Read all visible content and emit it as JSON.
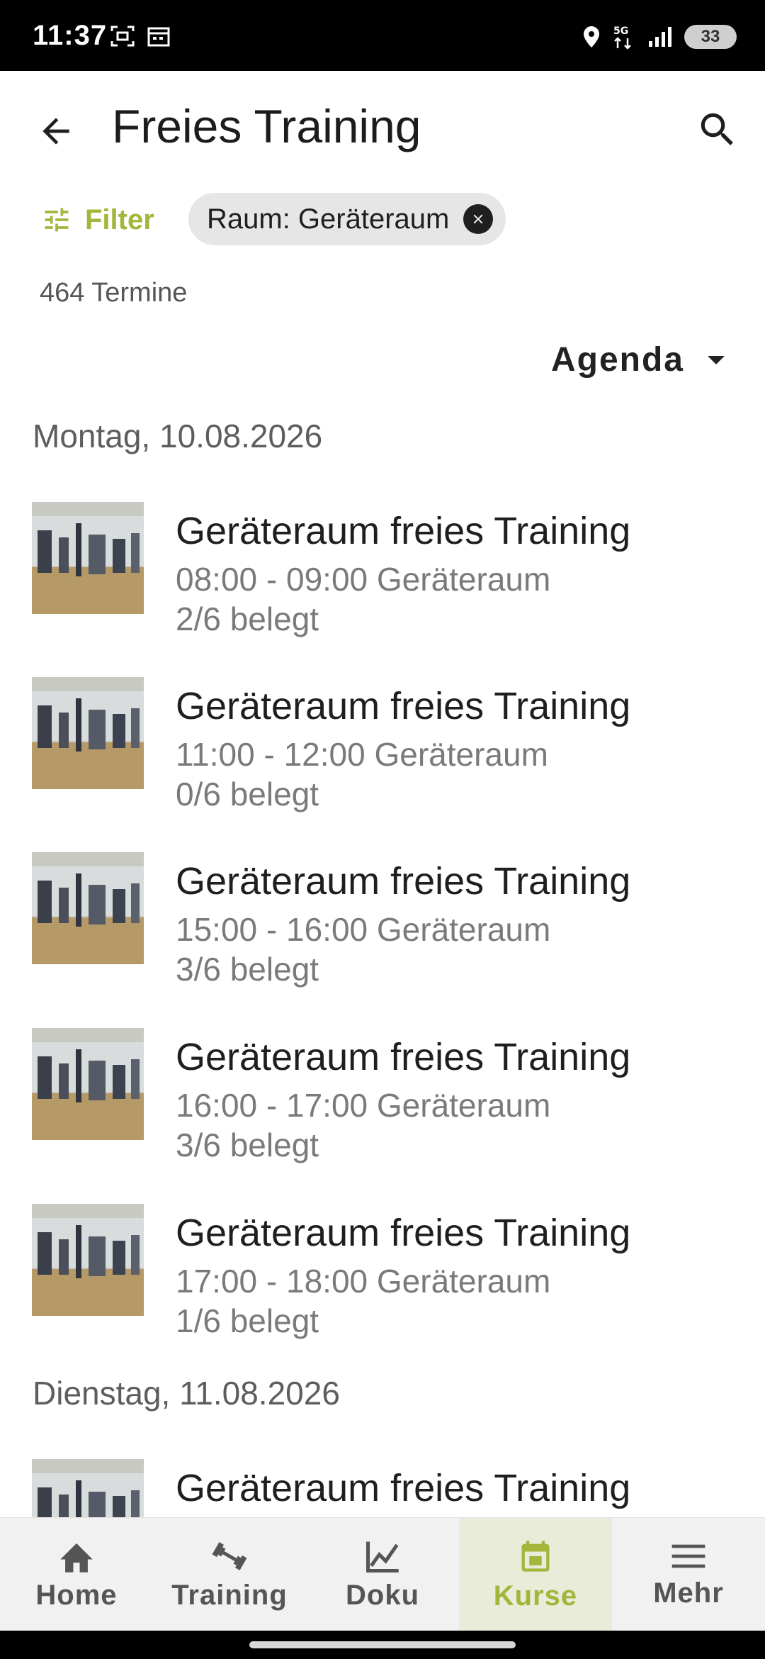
{
  "status_bar": {
    "time": "11:37",
    "battery": "33"
  },
  "app_bar": {
    "title": "Freies Training"
  },
  "filter": {
    "label": "Filter",
    "chip_label": "Raum: Geräteraum"
  },
  "result_count": "464 Termine",
  "view_selector": {
    "label": "Agenda"
  },
  "days": [
    {
      "header": "Montag, 10.08.2026",
      "events": [
        {
          "title": "Geräteraum freies Training",
          "time_room": "08:00 - 09:00 Geräteraum",
          "occupancy": "2/6 belegt"
        },
        {
          "title": "Geräteraum freies Training",
          "time_room": "11:00 - 12:00 Geräteraum",
          "occupancy": "0/6 belegt"
        },
        {
          "title": "Geräteraum freies Training",
          "time_room": "15:00 - 16:00 Geräteraum",
          "occupancy": "3/6 belegt"
        },
        {
          "title": "Geräteraum freies Training",
          "time_room": "16:00 - 17:00 Geräteraum",
          "occupancy": "3/6 belegt"
        },
        {
          "title": "Geräteraum freies Training",
          "time_room": "17:00 - 18:00 Geräteraum",
          "occupancy": "1/6 belegt"
        }
      ]
    },
    {
      "header": "Dienstag, 11.08.2026",
      "events": [
        {
          "title": "Geräteraum freies Training"
        }
      ]
    }
  ],
  "bottom_nav": [
    {
      "label": "Home",
      "icon": "home-icon"
    },
    {
      "label": "Training",
      "icon": "dumbbell-icon"
    },
    {
      "label": "Doku",
      "icon": "chart-line-icon"
    },
    {
      "label": "Kurse",
      "icon": "calendar-icon",
      "active": true
    },
    {
      "label": "Mehr",
      "icon": "menu-icon"
    }
  ],
  "colors": {
    "accent": "#a4b53c",
    "active_nav_bg": "#e8ecd9"
  }
}
